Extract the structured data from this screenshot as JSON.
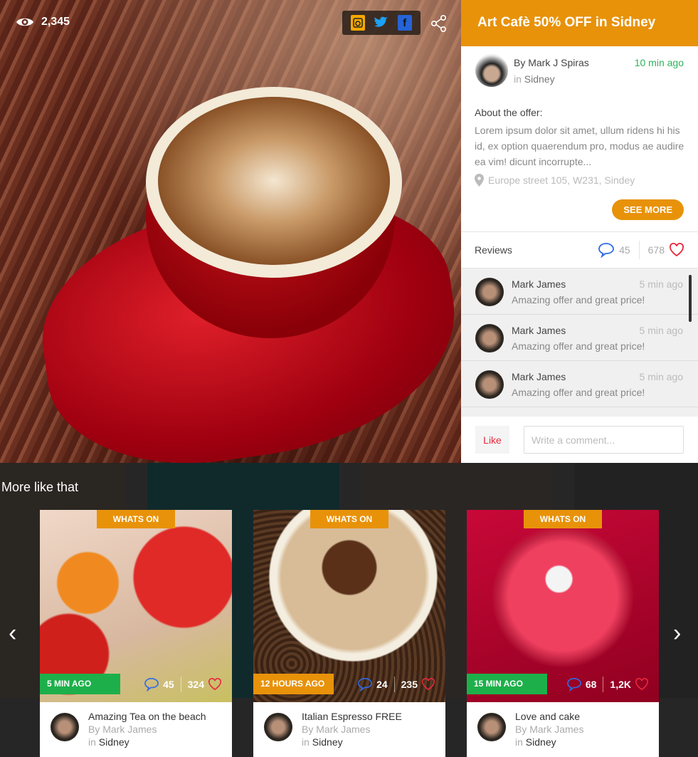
{
  "hero": {
    "views": "2,345",
    "social": [
      {
        "name": "instagram",
        "color": "#f5a800"
      },
      {
        "name": "twitter",
        "color": "#1da1f2"
      },
      {
        "name": "facebook",
        "color": "#2563d6",
        "glyph": "f"
      }
    ]
  },
  "offer": {
    "title": "Art Cafè 50% OFF in Sidney",
    "author": "By Mark J Spiras",
    "in_label": "in",
    "location": "Sidney",
    "time": "10 min ago",
    "about_label": "About the offer:",
    "description": "Lorem ipsum dolor sit amet, ullum ridens hi his id, ex option quaerendum pro, modus ae audire ea vim! dicunt incorrupte...",
    "address": "Europe street 105, W231, Sindey",
    "see_more": "SEE MORE"
  },
  "reviews": {
    "label": "Reviews",
    "comments": "45",
    "likes": "678",
    "items": [
      {
        "name": "Mark James",
        "text": "Amazing offer and great price!",
        "time": "5 min ago"
      },
      {
        "name": "Mark James",
        "text": "Amazing offer and great price!",
        "time": "5 min ago"
      },
      {
        "name": "Mark James",
        "text": "Amazing offer and great price!",
        "time": "5 min ago"
      }
    ]
  },
  "comment": {
    "like": "Like",
    "placeholder": "Write a comment..."
  },
  "more": {
    "title": "More like that",
    "cards": [
      {
        "tag": "WHATS ON",
        "ago": "5 MIN AGO",
        "ago_color": "#1db04a",
        "comments": "45",
        "likes": "324",
        "title": "Amazing Tea on the beach",
        "author": "By Mark James",
        "in_label": "in",
        "location": "Sidney"
      },
      {
        "tag": "WHATS ON",
        "ago": "12 HOURS AGO",
        "ago_color": "#e8920a",
        "comments": "24",
        "likes": "235",
        "title": "Italian Espresso FREE",
        "author": "By Mark James",
        "in_label": "in",
        "location": "Sidney"
      },
      {
        "tag": "WHATS ON",
        "ago": "15 MIN AGO",
        "ago_color": "#1db04a",
        "comments": "68",
        "likes": "1,2K",
        "title": "Love and cake",
        "author": "By Mark James",
        "in_label": "in",
        "location": "Sidney"
      }
    ]
  },
  "colors": {
    "accent": "#e8920a",
    "green": "#2db35a",
    "heart": "#e8283c",
    "comment": "#2e6be6"
  }
}
